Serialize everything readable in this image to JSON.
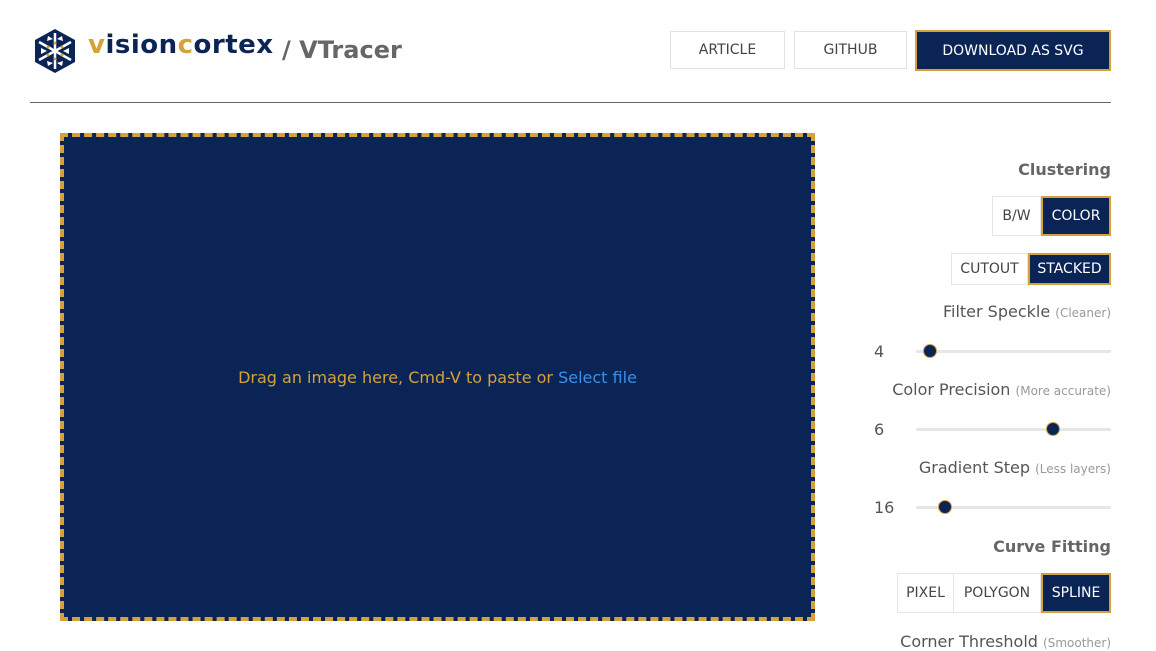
{
  "header": {
    "brand_prefix_gold": "v",
    "brand_mid": "ision",
    "brand_c_gold": "c",
    "brand_suffix": "ortex",
    "app_name": "/ VTracer",
    "buttons": {
      "article": "ARTICLE",
      "github": "GITHUB",
      "download": "DOWNLOAD AS SVG"
    }
  },
  "dropzone": {
    "text": "Drag an image here, Cmd-V to paste or ",
    "link": "Select file"
  },
  "panel": {
    "clustering": {
      "title": "Clustering",
      "mode_options": [
        "B/W",
        "COLOR"
      ],
      "mode_selected": "COLOR",
      "hierarchy_options": [
        "CUTOUT",
        "STACKED"
      ],
      "hierarchy_selected": "STACKED"
    },
    "filter_speckle": {
      "label": "Filter Speckle",
      "hint": "(Cleaner)",
      "value": "4",
      "fraction": 0.07
    },
    "color_precision": {
      "label": "Color Precision",
      "hint": "(More accurate)",
      "value": "6",
      "fraction": 0.7
    },
    "gradient_step": {
      "label": "Gradient Step",
      "hint": "(Less layers)",
      "value": "16",
      "fraction": 0.15
    },
    "curve_fitting": {
      "title": "Curve Fitting",
      "options": [
        "PIXEL",
        "POLYGON",
        "SPLINE"
      ],
      "selected": "SPLINE"
    },
    "corner_threshold": {
      "label": "Corner Threshold",
      "hint": "(Smoother)"
    }
  },
  "colors": {
    "navy": "#0b2456",
    "gold": "#d4a23a",
    "link": "#3b8fe8"
  }
}
